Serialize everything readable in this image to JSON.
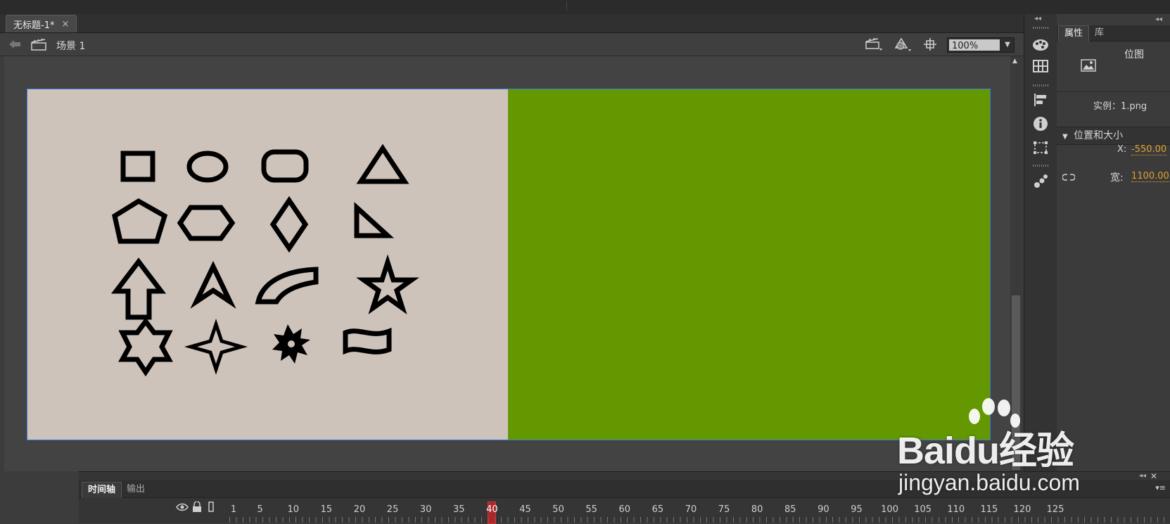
{
  "document": {
    "tab_title": "无标题-1*",
    "close_glyph": "×"
  },
  "scene_bar": {
    "back_icon": "back-arrow-icon",
    "scene_icon": "clapperboard-icon",
    "scene_label": "场景 1",
    "zoom": "100%",
    "edit_scene_icon": "clapperboard-icon",
    "edit_symbol_icon": "symbol-icon",
    "center_stage_icon": "crosshair-icon"
  },
  "stage": {
    "left_background": "#cec3bb",
    "right_background": "#649800",
    "shape_color": "#000000",
    "shapes": [
      "square",
      "ellipse",
      "rounded-rectangle",
      "triangle",
      "pentagon",
      "hexagon",
      "diamond",
      "right-triangle",
      "arrow-up",
      "arrowhead",
      "arc",
      "star-5",
      "star-6",
      "star-4",
      "burst",
      "wave-flag"
    ]
  },
  "toolbar_icons": [
    "palette-icon",
    "grid-icon",
    "align-icon",
    "info-icon",
    "transform-icon",
    "components-icon"
  ],
  "properties": {
    "tab_properties": "属性",
    "tab_library": "库",
    "type_label": "位图",
    "type_icon": "bitmap-icon",
    "instance_label": "实例：1.png",
    "section_title": "位置和大小",
    "x_label": "X:",
    "x_value": "-550.00",
    "width_label": "宽:",
    "width_value": "1100.00",
    "link_icon": "chain-link-icon"
  },
  "timeline": {
    "tab_timeline": "时间轴",
    "tab_output": "输出",
    "frame_numbers": [
      "1",
      "5",
      "10",
      "15",
      "20",
      "25",
      "30",
      "35",
      "40",
      "45",
      "50",
      "55",
      "60",
      "65",
      "70",
      "75",
      "80",
      "85",
      "90",
      "95",
      "100",
      "105",
      "110",
      "115",
      "120",
      "125"
    ],
    "current_frame": "40"
  },
  "watermark": {
    "main": "Baidu经验",
    "sub": "jingyan.baidu.com"
  }
}
